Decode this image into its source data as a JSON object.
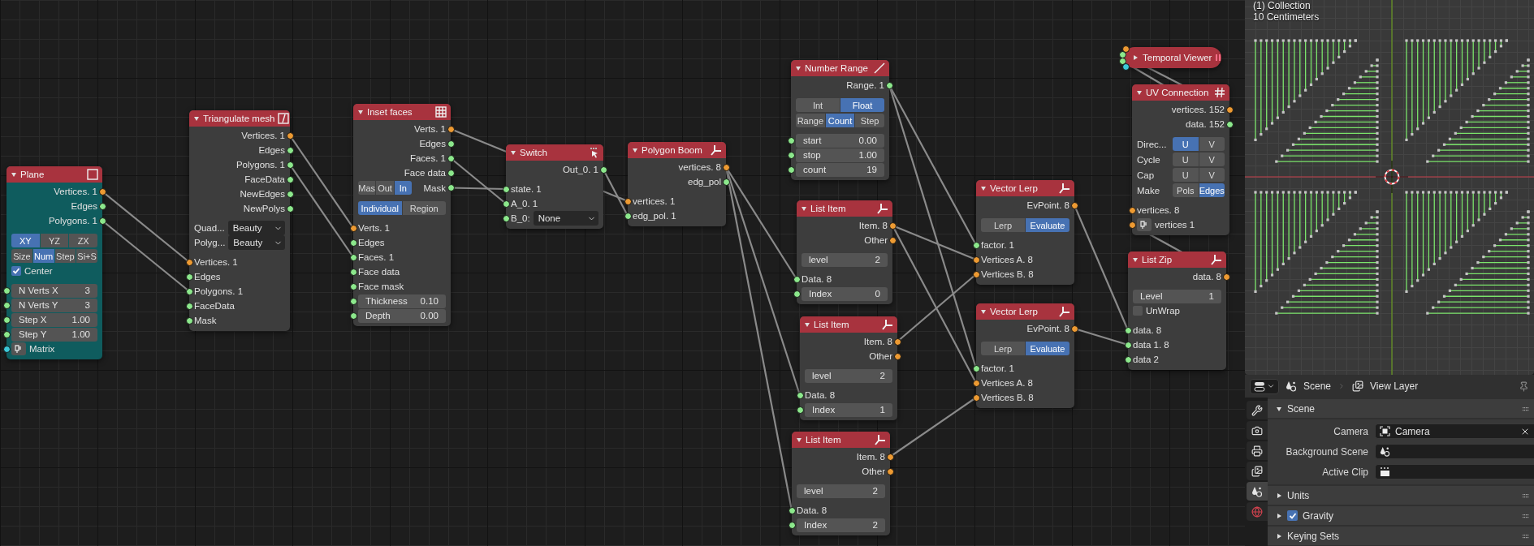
{
  "node_editor": {
    "nodes": [
      {
        "title": "Plane",
        "kind": "plane",
        "expanded": true,
        "color": "#0f5c5e",
        "rows": [
          {
            "kind": "out",
            "label": "Vertices. 1",
            "color": "#ed9a32"
          },
          {
            "kind": "out",
            "label": "Edges",
            "color": "#8ce88c"
          },
          {
            "kind": "out",
            "label": "Polygons. 1",
            "color": "#8ce88c"
          },
          {
            "kind": "seg",
            "options": [
              {
                "label": "XY",
                "selected": true
              },
              {
                "label": "YZ",
                "selected": false
              },
              {
                "label": "ZX",
                "selected": false
              }
            ]
          },
          {
            "kind": "seg",
            "options": [
              {
                "label": "Size",
                "selected": false
              },
              {
                "label": "Num",
                "selected": true
              },
              {
                "label": "Step",
                "selected": false
              },
              {
                "label": "Si+S",
                "selected": false
              }
            ]
          },
          {
            "kind": "check",
            "label": "Center",
            "checked": true
          },
          {
            "kind": "field",
            "label": "N Verts X",
            "value": "3",
            "color": "#8ce88c"
          },
          {
            "kind": "field",
            "label": "N Verts Y",
            "value": "3",
            "color": "#8ce88c"
          },
          {
            "kind": "field",
            "label": "Step X",
            "value": "1.00",
            "color": "#8ce88c"
          },
          {
            "kind": "field",
            "label": "Step Y",
            "value": "1.00",
            "color": "#8ce88c"
          },
          {
            "kind": "in_button",
            "label": "Matrix",
            "color": "#3cc8d8"
          }
        ]
      },
      {
        "title": "Triangulate mesh",
        "kind": "triangulate",
        "expanded": true,
        "color": "#3d3d3d",
        "rows": [
          {
            "kind": "out",
            "label": "Vertices. 1",
            "color": "#ed9a32"
          },
          {
            "kind": "out",
            "label": "Edges",
            "color": "#8ce88c"
          },
          {
            "kind": "out",
            "label": "Polygons. 1",
            "color": "#8ce88c"
          },
          {
            "kind": "out",
            "label": "FaceData",
            "color": "#8ce88c"
          },
          {
            "kind": "out",
            "label": "NewEdges",
            "color": "#8ce88c"
          },
          {
            "kind": "out",
            "label": "NewPolys",
            "color": "#8ce88c"
          },
          {
            "kind": "dropdown",
            "label": "Quad...",
            "value": "Beauty"
          },
          {
            "kind": "dropdown",
            "label": "Polyg...",
            "value": "Beauty"
          },
          {
            "kind": "in",
            "label": "Vertices. 1",
            "color": "#ed9a32"
          },
          {
            "kind": "in",
            "label": "Edges",
            "color": "#8ce88c"
          },
          {
            "kind": "in",
            "label": "Polygons. 1",
            "color": "#8ce88c"
          },
          {
            "kind": "in",
            "label": "FaceData",
            "color": "#8ce88c"
          },
          {
            "kind": "in",
            "label": "Mask",
            "color": "#8ce88c"
          }
        ]
      },
      {
        "title": "Inset faces",
        "kind": "inset",
        "expanded": true,
        "color": "#3d3d3d",
        "rows": [
          {
            "kind": "out",
            "label": "Verts. 1",
            "color": "#ed9a32"
          },
          {
            "kind": "out",
            "label": "Edges",
            "color": "#8ce88c"
          },
          {
            "kind": "out",
            "label": "Faces. 1",
            "color": "#8ce88c"
          },
          {
            "kind": "out",
            "label": "Face data",
            "color": "#8ce88c"
          },
          {
            "kind": "seg",
            "options": [
              {
                "label": "Mas",
                "selected": false
              },
              {
                "label": "Out",
                "selected": false
              },
              {
                "label": "In",
                "selected": true
              }
            ],
            "out_label": "Mask",
            "color": "#8ce88c"
          },
          {
            "kind": "seg",
            "options": [
              {
                "label": "Individual",
                "selected": true
              },
              {
                "label": "Region",
                "selected": false
              }
            ]
          },
          {
            "kind": "in",
            "label": "Verts. 1",
            "color": "#ed9a32"
          },
          {
            "kind": "in",
            "label": "Edges",
            "color": "#8ce88c"
          },
          {
            "kind": "in",
            "label": "Faces. 1",
            "color": "#8ce88c"
          },
          {
            "kind": "in",
            "label": "Face data",
            "color": "#8ce88c"
          },
          {
            "kind": "in",
            "label": "Face mask",
            "color": "#8ce88c"
          },
          {
            "kind": "field",
            "label": "Thickness",
            "value": "0.10",
            "color": "#8ce88c"
          },
          {
            "kind": "field",
            "label": "Depth",
            "value": "0.00",
            "color": "#8ce88c"
          }
        ]
      },
      {
        "title": "Switch",
        "kind": "switch",
        "expanded": true,
        "color": "#3d3d3d",
        "rows": [
          {
            "kind": "out",
            "label": "Out_0. 1",
            "color": "#8ce88c"
          },
          {
            "kind": "in",
            "label": "state. 1",
            "color": "#8ce88c"
          },
          {
            "kind": "in",
            "label": "A_0. 1",
            "color": "#8ce88c"
          },
          {
            "kind": "dropdown",
            "label": "B_0:",
            "value": "None",
            "color": "#8ce88c"
          }
        ]
      },
      {
        "title": "Polygon Boom",
        "kind": "split",
        "expanded": true,
        "color": "#3d3d3d",
        "rows": [
          {
            "kind": "out",
            "label": "vertices. 8",
            "color": "#ed9a32"
          },
          {
            "kind": "out",
            "label": "edg_pol",
            "color": "#8ce88c"
          },
          {
            "kind": "in",
            "label": "vertices. 1",
            "color": "#ed9a32"
          },
          {
            "kind": "in",
            "label": "edg_pol. 1",
            "color": "#8ce88c"
          }
        ]
      },
      {
        "title": "Number Range",
        "kind": "range",
        "expanded": true,
        "color": "#3d3d3d",
        "rows": [
          {
            "kind": "out",
            "label": "Range. 1",
            "color": "#8ce88c"
          },
          {
            "kind": "seg",
            "options": [
              {
                "label": "Int",
                "selected": false
              },
              {
                "label": "Float",
                "selected": true
              }
            ]
          },
          {
            "kind": "seg",
            "options": [
              {
                "label": "Range",
                "selected": false
              },
              {
                "label": "Count",
                "selected": true
              },
              {
                "label": "Step",
                "selected": false
              }
            ]
          },
          {
            "kind": "field",
            "label": "start",
            "value": "0.00",
            "color": "#8ce88c"
          },
          {
            "kind": "field",
            "label": "stop",
            "value": "1.00",
            "color": "#8ce88c"
          },
          {
            "kind": "field",
            "label": "count",
            "value": "19",
            "color": "#8ce88c"
          }
        ]
      },
      {
        "title": "List Item",
        "kind": "split",
        "expanded": true,
        "color": "#3d3d3d",
        "rows": [
          {
            "kind": "out",
            "label": "Item. 8",
            "color": "#ed9a32"
          },
          {
            "kind": "out",
            "label": "Other",
            "color": "#ed9a32"
          },
          {
            "kind": "field",
            "label": "level",
            "value": "2"
          },
          {
            "kind": "in",
            "label": "Data. 8",
            "color": "#8ce88c"
          },
          {
            "kind": "field",
            "label": "Index",
            "value": "0",
            "color": "#8ce88c"
          }
        ]
      },
      {
        "title": "List Item",
        "kind": "split",
        "expanded": true,
        "color": "#3d3d3d",
        "rows": [
          {
            "kind": "out",
            "label": "Item. 8",
            "color": "#ed9a32"
          },
          {
            "kind": "out",
            "label": "Other",
            "color": "#ed9a32"
          },
          {
            "kind": "field",
            "label": "level",
            "value": "2"
          },
          {
            "kind": "in",
            "label": "Data. 8",
            "color": "#8ce88c"
          },
          {
            "kind": "field",
            "label": "Index",
            "value": "1",
            "color": "#8ce88c"
          }
        ]
      },
      {
        "title": "List Item",
        "kind": "split",
        "expanded": true,
        "color": "#3d3d3d",
        "rows": [
          {
            "kind": "out",
            "label": "Item. 8",
            "color": "#ed9a32"
          },
          {
            "kind": "out",
            "label": "Other",
            "color": "#ed9a32"
          },
          {
            "kind": "field",
            "label": "level",
            "value": "2"
          },
          {
            "kind": "in",
            "label": "Data. 8",
            "color": "#8ce88c"
          },
          {
            "kind": "field",
            "label": "Index",
            "value": "2",
            "color": "#8ce88c"
          }
        ]
      },
      {
        "title": "Vector Lerp",
        "kind": "split",
        "expanded": true,
        "color": "#3d3d3d",
        "rows": [
          {
            "kind": "out",
            "label": "EvPoint. 8",
            "color": "#ed9a32"
          },
          {
            "kind": "seg",
            "options": [
              {
                "label": "Lerp",
                "selected": false
              },
              {
                "label": "Evaluate",
                "selected": true
              }
            ]
          },
          {
            "kind": "in",
            "label": "factor. 1",
            "color": "#8ce88c"
          },
          {
            "kind": "in",
            "label": "Vertices A. 8",
            "color": "#ed9a32"
          },
          {
            "kind": "in",
            "label": "Vertices B. 8",
            "color": "#ed9a32"
          }
        ]
      },
      {
        "title": "Vector Lerp",
        "kind": "split",
        "expanded": true,
        "color": "#3d3d3d",
        "rows": [
          {
            "kind": "out",
            "label": "EvPoint. 8",
            "color": "#ed9a32"
          },
          {
            "kind": "seg",
            "options": [
              {
                "label": "Lerp",
                "selected": false
              },
              {
                "label": "Evaluate",
                "selected": true
              }
            ]
          },
          {
            "kind": "in",
            "label": "factor. 1",
            "color": "#8ce88c"
          },
          {
            "kind": "in",
            "label": "Vertices A. 8",
            "color": "#ed9a32"
          },
          {
            "kind": "in",
            "label": "Vertices B. 8",
            "color": "#ed9a32"
          }
        ]
      },
      {
        "title": "Temporal Viewer",
        "kind": "viewer",
        "expanded": false,
        "color": "#a8333e",
        "sockets": [
          {
            "color": "#ed9a32"
          },
          {
            "color": "#8ce88c"
          },
          {
            "color": "#8ce88c"
          },
          {
            "color": "#3cc8d8"
          }
        ]
      },
      {
        "title": "UV Connection",
        "kind": "hash",
        "expanded": true,
        "color": "#3d3d3d",
        "rows": [
          {
            "kind": "out",
            "label": "vertices. 152",
            "color": "#ed9a32"
          },
          {
            "kind": "out",
            "label": "data. 152",
            "color": "#8ce88c"
          },
          {
            "kind": "seg",
            "label": "Direc...",
            "options": [
              {
                "label": "U",
                "selected": true
              },
              {
                "label": "V",
                "selected": false
              }
            ]
          },
          {
            "kind": "seg",
            "label": "Cycle",
            "options": [
              {
                "label": "U",
                "selected": false
              },
              {
                "label": "V",
                "selected": false
              }
            ]
          },
          {
            "kind": "seg",
            "label": "Cap",
            "options": [
              {
                "label": "U",
                "selected": false
              },
              {
                "label": "V",
                "selected": false
              }
            ]
          },
          {
            "kind": "seg",
            "label": "Make",
            "options": [
              {
                "label": "Pols",
                "selected": false
              },
              {
                "label": "Edges",
                "selected": true
              }
            ]
          },
          {
            "kind": "in",
            "label": "vertices. 8",
            "color": "#ed9a32"
          },
          {
            "kind": "in_button",
            "label": "vertices 1",
            "color": "#ed9a32"
          }
        ]
      },
      {
        "title": "List Zip",
        "kind": "split",
        "expanded": true,
        "color": "#3d3d3d",
        "rows": [
          {
            "kind": "out",
            "label": "data. 8",
            "color": "#ed9a32"
          },
          {
            "kind": "field",
            "label": "Level",
            "value": "1"
          },
          {
            "kind": "check",
            "label": "UnWrap",
            "checked": false
          },
          {
            "kind": "in",
            "label": "data. 8",
            "color": "#8ce88c"
          },
          {
            "kind": "in",
            "label": "data 1. 8",
            "color": "#8ce88c"
          },
          {
            "kind": "in",
            "label": "data 2",
            "color": "#8ce88c"
          }
        ]
      }
    ]
  },
  "viewport": {
    "collection_label": "(1) Collection",
    "scale_label": "10 Centimeters"
  },
  "properties": {
    "header": {
      "scene": "Scene",
      "view_layer": "View Layer"
    },
    "tabs": [
      {
        "kind": "tool",
        "selected": false
      },
      {
        "kind": "render",
        "selected": false
      },
      {
        "kind": "output",
        "selected": false
      },
      {
        "kind": "view_layer",
        "selected": false
      },
      {
        "kind": "scene",
        "selected": true
      },
      {
        "kind": "world",
        "selected": false
      }
    ],
    "sections": [
      {
        "title": "Scene",
        "expanded": true,
        "fields": [
          {
            "label": "Camera",
            "kind": "camera",
            "value": "Camera"
          },
          {
            "label": "Background Scene",
            "kind": "scene"
          },
          {
            "label": "Active Clip",
            "kind": "clip"
          }
        ]
      },
      {
        "title": "Units",
        "expanded": false
      },
      {
        "title": "Gravity",
        "expanded": false,
        "checked": true
      },
      {
        "title": "Keying Sets",
        "expanded": false
      }
    ]
  }
}
